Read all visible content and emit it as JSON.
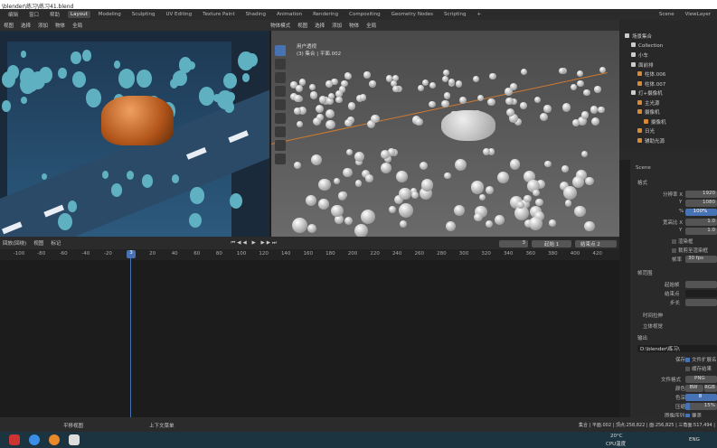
{
  "window_title": "\\blender\\练习\\练习41.blend",
  "menu": [
    "编辑",
    "窗口",
    "帮助"
  ],
  "workspaces": [
    "Layout",
    "Modeling",
    "Sculpting",
    "UV Editing",
    "Texture Paint",
    "Shading",
    "Animation",
    "Rendering",
    "Compositing",
    "Geometry Nodes",
    "Scripting",
    "+"
  ],
  "scene": "Scene",
  "view_layer": "ViewLayer",
  "header_left": [
    "视图",
    "选择",
    "添加",
    "物体",
    "全局"
  ],
  "header_right": [
    "物体模式",
    "视图",
    "选择",
    "添加",
    "物体",
    "全局"
  ],
  "viewport": {
    "view_name": "用户透视",
    "context": "(3) 集合 | 平面.002"
  },
  "timeline": {
    "menu": [
      "回放(回绕)",
      "视图",
      "标记"
    ],
    "ticks": [
      "-100",
      "-80",
      "-60",
      "-40",
      "-20",
      "20",
      "40",
      "60",
      "80",
      "100",
      "120",
      "140",
      "160",
      "180",
      "200",
      "220",
      "240",
      "260",
      "280",
      "300",
      "320",
      "340",
      "360",
      "380",
      "400",
      "420"
    ],
    "current_frame": "3",
    "start_label": "起始",
    "start": "1",
    "end_label": "结束点",
    "end": "2"
  },
  "outliner": {
    "items": [
      "场景集合",
      "Collection",
      "小车",
      "面前排",
      "柱体.006",
      "柱体.007",
      "灯+摄像机",
      "主光源",
      "摄像机",
      "摄像机",
      "日光",
      "辅助光源"
    ]
  },
  "properties": {
    "scene": "Scene",
    "format_section": "格式",
    "res_x_label": "分辨率 X",
    "res_x": "1920",
    "y_label": "Y",
    "res_y": "1080",
    "pct_label": "%",
    "pct": "100%",
    "aspect_label": "宽高比 X",
    "aspect_x": "1.0",
    "aspect_y": "1.0",
    "render_region": "渲染框",
    "crop": "裁剪至渲染框",
    "fps_label": "帧率",
    "fps": "30 fps",
    "frame_range": "帧范围",
    "start_label": "起始帧",
    "end_label": "结束点",
    "step_label": "步长",
    "time_stretch": "时间拉伸",
    "stereo": "立体视觉",
    "output": "输出",
    "path": "D:\\blender\\练习\\",
    "save_label": "保存",
    "file_ext": "文件扩展名",
    "cache": "缓存结果",
    "file_format_label": "文件格式",
    "file_format": "PNG",
    "color_label": "颜色",
    "bw": "BW",
    "rgb": "RGB",
    "depth_label": "色深",
    "depth8": "8",
    "compress_label": "压缩",
    "compress": "15%",
    "seq_label": "图像序列",
    "overwrite": "覆盖"
  },
  "status": {
    "left": "平移视图",
    "mid": "上下文菜单",
    "right": "集合 | 平面.002 | 顶点:258,822 | 面:256,825 | 三角面:517,494 |"
  },
  "taskbar": {
    "temp": "20°C",
    "cpu": "CPU温度",
    "lang": "ENG"
  }
}
